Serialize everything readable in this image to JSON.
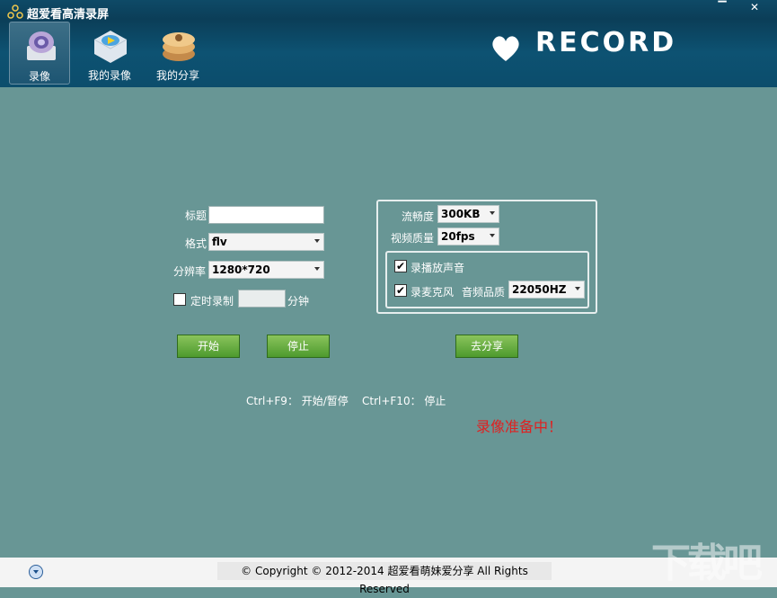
{
  "app": {
    "title": "超爱看高清录屏"
  },
  "window": {
    "minimize": "▔",
    "close": "✕"
  },
  "nav": [
    {
      "label": "录像",
      "icon": "record-camera-icon"
    },
    {
      "label": "我的录像",
      "icon": "my-videos-icon"
    },
    {
      "label": "我的分享",
      "icon": "my-shares-icon"
    }
  ],
  "brand": {
    "text": "RECORD"
  },
  "form": {
    "title_label": "标题",
    "title_value": "",
    "format_label": "格式",
    "format_value": "flv",
    "resolution_label": "分辨率",
    "resolution_value": "1280*720",
    "timer_label": "定时录制",
    "timer_value": "",
    "timer_unit": "分钟"
  },
  "settings": {
    "fluency_label": "流畅度",
    "fluency_value": "300KB",
    "quality_label": "视频质量",
    "quality_value": "20fps",
    "sound_label": "录播放声音",
    "sound_checked": true,
    "mic_label": "录麦克风",
    "mic_checked": true,
    "audio_quality_label": "音频品质",
    "audio_quality_value": "22050HZ"
  },
  "buttons": {
    "start": "开始",
    "stop": "停止",
    "share": "去分享"
  },
  "hotkeys": {
    "start_pause": "Ctrl+F9： 开始/暂停",
    "stop": "Ctrl+F10： 停止"
  },
  "status": "录像准备中！",
  "footer": {
    "copyright": "© Copyright © 2012-2014 超爱看萌妹爱分享 All Rights Reserved"
  },
  "watermark": "下载吧",
  "colors": {
    "titlebar": "#0c4d6c",
    "body": "#689695",
    "button": "#5ea83a",
    "status": "#e02020"
  }
}
